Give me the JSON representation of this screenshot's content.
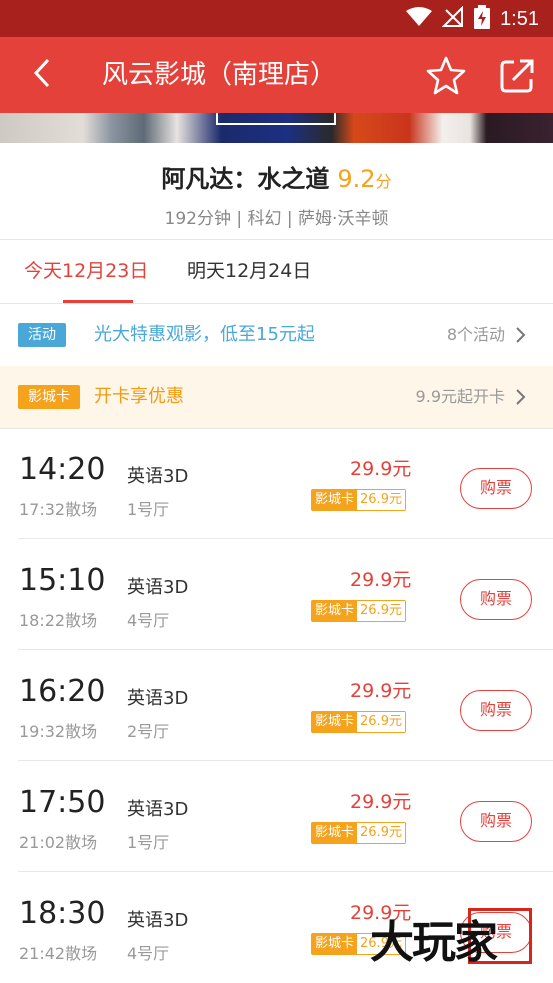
{
  "status_bar": {
    "time": "1:51"
  },
  "header": {
    "title": "风云影城（南理店）"
  },
  "movie": {
    "title": "阿凡达：水之道",
    "score": "9.2",
    "score_unit": "分",
    "meta": "192分钟 | 科幻 | 萨姆·沃辛顿"
  },
  "date_tabs": [
    {
      "label": "今天12月23日",
      "active": true
    },
    {
      "label": "明天12月24日",
      "active": false
    }
  ],
  "activity": {
    "tag": "活动",
    "text": "光大特惠观影，低至15元起",
    "right": "8个活动"
  },
  "member_card": {
    "tag": "影城卡",
    "text": "开卡享优惠",
    "right": "9.9元起开卡"
  },
  "showtimes": [
    {
      "start": "14:20",
      "end": "17:32散场",
      "lang": "英语3D",
      "hall": "1号厅",
      "price": "29.9元",
      "card_label": "影城卡",
      "card_price": "26.9元",
      "buy": "购票"
    },
    {
      "start": "15:10",
      "end": "18:22散场",
      "lang": "英语3D",
      "hall": "4号厅",
      "price": "29.9元",
      "card_label": "影城卡",
      "card_price": "26.9元",
      "buy": "购票"
    },
    {
      "start": "16:20",
      "end": "19:32散场",
      "lang": "英语3D",
      "hall": "2号厅",
      "price": "29.9元",
      "card_label": "影城卡",
      "card_price": "26.9元",
      "buy": "购票"
    },
    {
      "start": "17:50",
      "end": "21:02散场",
      "lang": "英语3D",
      "hall": "1号厅",
      "price": "29.9元",
      "card_label": "影城卡",
      "card_price": "26.9元",
      "buy": "购票"
    },
    {
      "start": "18:30",
      "end": "21:42散场",
      "lang": "英语3D",
      "hall": "4号厅",
      "price": "29.9元",
      "card_label": "影城卡",
      "card_price": "26.9元",
      "buy": "购票"
    }
  ],
  "watermark": {
    "text": "大玩家"
  },
  "colors": {
    "status_bar": "#a8211c",
    "header": "#e5413b",
    "accent": "#e5413b",
    "score": "#f5a21c",
    "activity_tag": "#4aa8d8",
    "card_tag": "#f5a21c"
  },
  "icons": {
    "back": "chevron-left-icon",
    "favorite": "star-outline-icon",
    "share": "share-icon",
    "wifi": "wifi-icon",
    "signal": "no-signal-icon",
    "battery": "battery-charging-icon",
    "more": "chevron-right-icon"
  }
}
